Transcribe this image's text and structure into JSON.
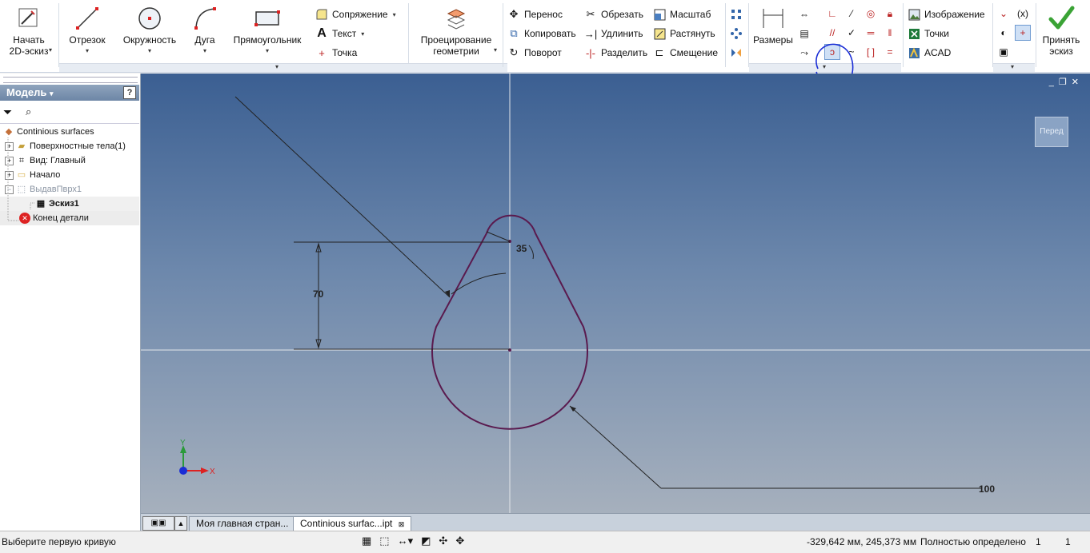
{
  "ribbon": {
    "start_sketch": "Начать\n2D-эскиз",
    "draw": {
      "line": "Отрезок",
      "circle": "Окружность",
      "arc": "Дуга",
      "rectangle": "Прямоугольник",
      "fillet": "Сопряжение",
      "text": "Текст",
      "point": "Точка"
    },
    "project_geometry": "Проецирование\nгеометрии",
    "modify": {
      "move": "Перенос",
      "copy": "Копировать",
      "rotate": "Поворот",
      "trim": "Обрезать",
      "extend": "Удлинить",
      "split": "Разделить",
      "scale": "Масштаб",
      "stretch": "Растянуть",
      "offset": "Смещение"
    },
    "dimensions": "Размеры",
    "insert": {
      "image": "Изображение",
      "points": "Точки",
      "acad": "ACAD"
    },
    "finish": "Принять\nэскиз"
  },
  "browser": {
    "title": "Модель",
    "tree": [
      {
        "label": "Continious surfaces"
      },
      {
        "label": "Поверхностные тела(1)"
      },
      {
        "label": "Вид: Главный"
      },
      {
        "label": "Начало"
      },
      {
        "label": "ВыдавПврх1"
      },
      {
        "label": "Эскиз1"
      },
      {
        "label": "Конец детали"
      }
    ]
  },
  "viewcube_label": "Перед",
  "dimensions": {
    "radius": "35",
    "height": "70",
    "leader": "100"
  },
  "axis_labels": {
    "y": "Y",
    "x": "X"
  },
  "tabs": [
    {
      "label": "Моя главная стран..."
    },
    {
      "label": "Continious surfac...ipt"
    }
  ],
  "status": {
    "prompt": "Выберите первую кривую",
    "coords": "-329,642 мм, 245,373 мм",
    "constraint_state": "Полностью определено",
    "count1": "1",
    "count2": "1"
  },
  "colors": {
    "profile": "#5a1a4e",
    "annotation_highlight": "#1a2dd6",
    "background_top": "#3b5f92",
    "background_bottom": "#a6b0bd"
  }
}
